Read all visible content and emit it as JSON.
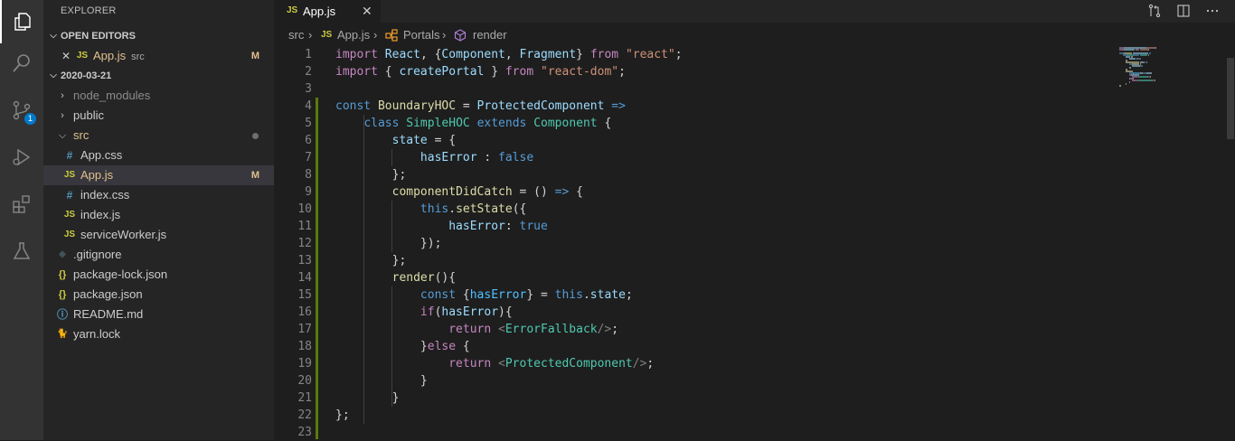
{
  "activity_bar": {
    "icons": [
      "explorer-icon",
      "search-icon",
      "source-control-icon",
      "run-debug-icon",
      "extensions-icon",
      "testing-icon"
    ],
    "scm_badge": "1"
  },
  "sidebar": {
    "title": "EXPLORER",
    "open_editors": {
      "header": "OPEN EDITORS",
      "items": [
        {
          "icon": "JS",
          "name": "App.js",
          "desc": "src",
          "status": "M"
        }
      ]
    },
    "workspace": {
      "header": "2020-03-21",
      "items": [
        {
          "icon": "",
          "name": "node_modules",
          "type": "folder"
        },
        {
          "icon": "",
          "name": "public",
          "type": "folder"
        },
        {
          "icon": "",
          "name": "src",
          "type": "folder-open"
        },
        {
          "icon": "#",
          "name": "App.css",
          "type": "file"
        },
        {
          "icon": "JS",
          "name": "App.js",
          "type": "file",
          "status": "M"
        },
        {
          "icon": "#",
          "name": "index.css",
          "type": "file"
        },
        {
          "icon": "JS",
          "name": "index.js",
          "type": "file"
        },
        {
          "icon": "JS",
          "name": "serviceWorker.js",
          "type": "file"
        },
        {
          "icon": "◆",
          "name": ".gitignore",
          "type": "file"
        },
        {
          "icon": "{}",
          "name": "package-lock.json",
          "type": "file"
        },
        {
          "icon": "{}",
          "name": "package.json",
          "type": "file"
        },
        {
          "icon": "ⓘ",
          "name": "README.md",
          "type": "file"
        },
        {
          "icon": "🐈",
          "name": "yarn.lock",
          "type": "file"
        }
      ]
    }
  },
  "tab": {
    "icon": "JS",
    "label": "App.js",
    "close": "✕"
  },
  "breadcrumb": [
    "src",
    "JS",
    "App.js",
    "Portals",
    "render"
  ],
  "editor": {
    "line_numbers": [
      "1",
      "2",
      "3",
      "4",
      "5",
      "6",
      "7",
      "8",
      "9",
      "10",
      "11",
      "12",
      "13",
      "14",
      "15",
      "16",
      "17",
      "18",
      "19",
      "20",
      "21",
      "22",
      "23"
    ]
  },
  "colors": {
    "activity_bg": "#333333",
    "sidebar_bg": "#252526",
    "editor_bg": "#1e1e1e",
    "modified": "#e2c08d",
    "accent": "#007acc"
  }
}
